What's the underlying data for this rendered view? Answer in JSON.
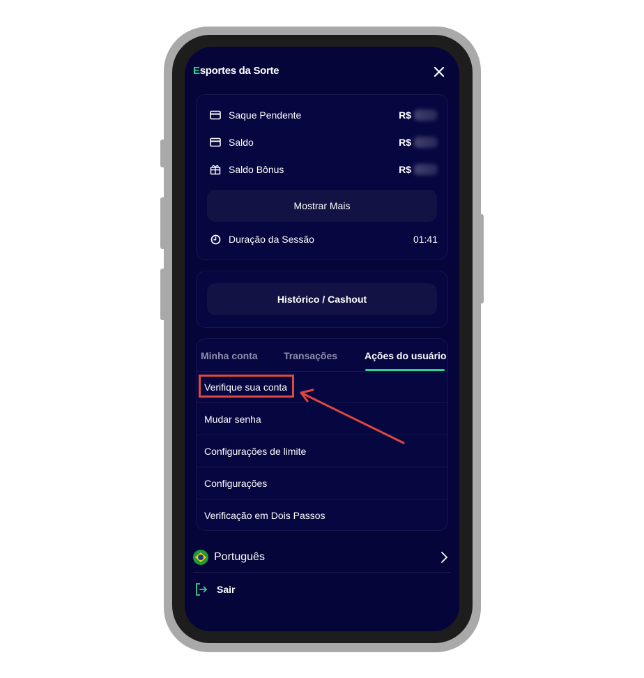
{
  "header": {
    "logo_prefix": "E",
    "logo_text": "sportes da Sorte"
  },
  "balance": {
    "items": [
      {
        "label": "Saque Pendente",
        "currency": "R$",
        "icon": "card-icon"
      },
      {
        "label": "Saldo",
        "currency": "R$",
        "icon": "card-icon"
      },
      {
        "label": "Saldo Bônus",
        "currency": "R$",
        "icon": "gift-icon"
      }
    ],
    "show_more_label": "Mostrar Mais",
    "session_label": "Duração da Sessão",
    "session_value": "01:41"
  },
  "history_label": "Histórico / Cashout",
  "tabs": [
    {
      "label": "Minha conta"
    },
    {
      "label": "Transações"
    },
    {
      "label": "Ações do usuário"
    }
  ],
  "active_tab": "Ações do usuário",
  "menu": [
    {
      "label": "Verifique sua conta"
    },
    {
      "label": "Mudar senha"
    },
    {
      "label": "Configurações de limite"
    },
    {
      "label": "Configurações"
    },
    {
      "label": "Verificação em Dois Passos"
    }
  ],
  "language": {
    "label": "Português",
    "flag": "brazil-flag-icon"
  },
  "logout_label": "Sair",
  "colors": {
    "background": "#05053a",
    "accent": "#2fd38f",
    "highlight": "#e0473e"
  }
}
